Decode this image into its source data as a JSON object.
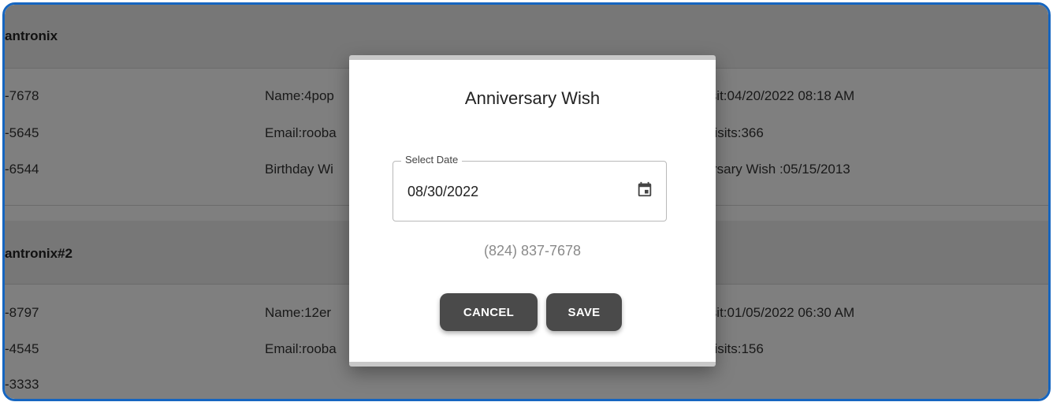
{
  "background": {
    "groups": [
      {
        "header": "antronix",
        "rows": [
          {
            "col1": "-7678",
            "col2": "Name:4pop",
            "col3": "Visit:04/20/2022 08:18 AM"
          },
          {
            "col1": "-5645",
            "col2": "Email:rooba",
            "col3": "f Visits:366"
          },
          {
            "col1": "-6544",
            "col2": "Birthday Wi",
            "col3": "versary Wish :05/15/2013"
          }
        ]
      },
      {
        "header": "antronix#2",
        "rows": [
          {
            "col1": "-8797",
            "col2": "Name:12er",
            "col3": "Visit:01/05/2022 06:30 AM"
          },
          {
            "col1": "-4545",
            "col2": "Email:rooba",
            "col3": "f Visits:156"
          },
          {
            "col1": "-3333",
            "col2": "",
            "col3": ""
          }
        ]
      }
    ]
  },
  "dialog": {
    "title": "Anniversary Wish",
    "date_field": {
      "label": "Select Date",
      "value": "08/30/2022",
      "icon": "calendar-icon"
    },
    "phone": "(824) 837-7678",
    "cancel_label": "CANCEL",
    "save_label": "SAVE"
  },
  "colors": {
    "frame_border": "#1565c0",
    "button_bg": "#4a4a4a",
    "overlay": "rgba(0,0,0,0.5)"
  }
}
